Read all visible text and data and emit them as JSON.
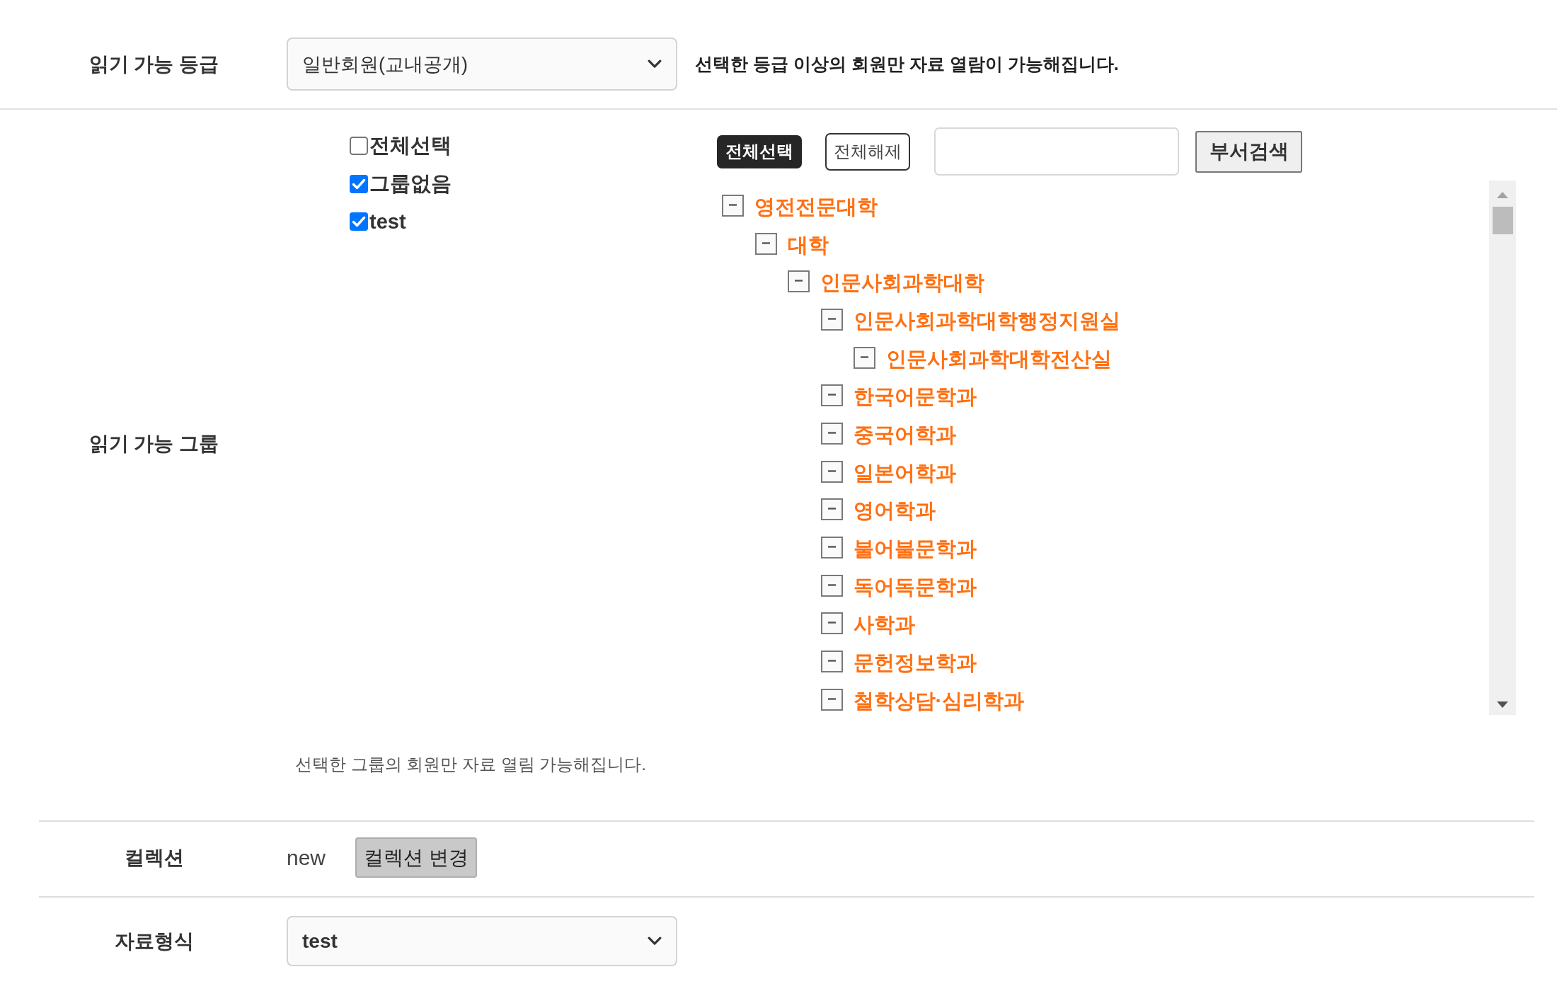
{
  "read_grade": {
    "label": "읽기 가능 등급",
    "select": {
      "value": "일반회원(교내공개)"
    },
    "description": "선택한 등급 이상의 회원만 자료 열람이 가능해집니다."
  },
  "read_group": {
    "label": "읽기 가능 그룹",
    "checkboxes": [
      {
        "label": "전체선택",
        "checked": false
      },
      {
        "label": "그룹없음",
        "checked": true
      },
      {
        "label": "test",
        "checked": true
      }
    ],
    "department_tree": {
      "buttons": [
        {
          "label": "전체선택",
          "kind": "dark"
        },
        {
          "label": "전체해제",
          "kind": "outline"
        }
      ],
      "search_button": "부서검색",
      "nodes": [
        {
          "label": "영전전문대학",
          "expanded": true,
          "children": [
            {
              "label": "대학",
              "expanded": true,
              "children": [
                {
                  "label": "인문사회과학대학",
                  "expanded": true,
                  "children": [
                    {
                      "label": "인문사회과학대학행정지원실",
                      "expanded": true,
                      "children": [
                        {
                          "label": "인문사회과학대학전산실",
                          "expanded": true
                        }
                      ]
                    },
                    {
                      "label": "한국어문학과",
                      "expanded": true
                    },
                    {
                      "label": "중국어학과",
                      "expanded": true
                    },
                    {
                      "label": "일본어학과",
                      "expanded": true
                    },
                    {
                      "label": "영어학과",
                      "expanded": true
                    },
                    {
                      "label": "불어불문학과",
                      "expanded": true
                    },
                    {
                      "label": "독어독문학과",
                      "expanded": true
                    },
                    {
                      "label": "사학과",
                      "expanded": true
                    },
                    {
                      "label": "문헌정보학과",
                      "expanded": true
                    },
                    {
                      "label": "철학상담·심리학과",
                      "expanded": true
                    }
                  ]
                }
              ]
            }
          ]
        }
      ]
    },
    "hint": "선택한 그룹의 회원만 자료 열림 가능해집니다."
  },
  "collection": {
    "label": "컬렉션",
    "value": "new",
    "button": "컬렉션 변경"
  },
  "data_format": {
    "label": "자료형식",
    "select": {
      "value": "test"
    }
  }
}
